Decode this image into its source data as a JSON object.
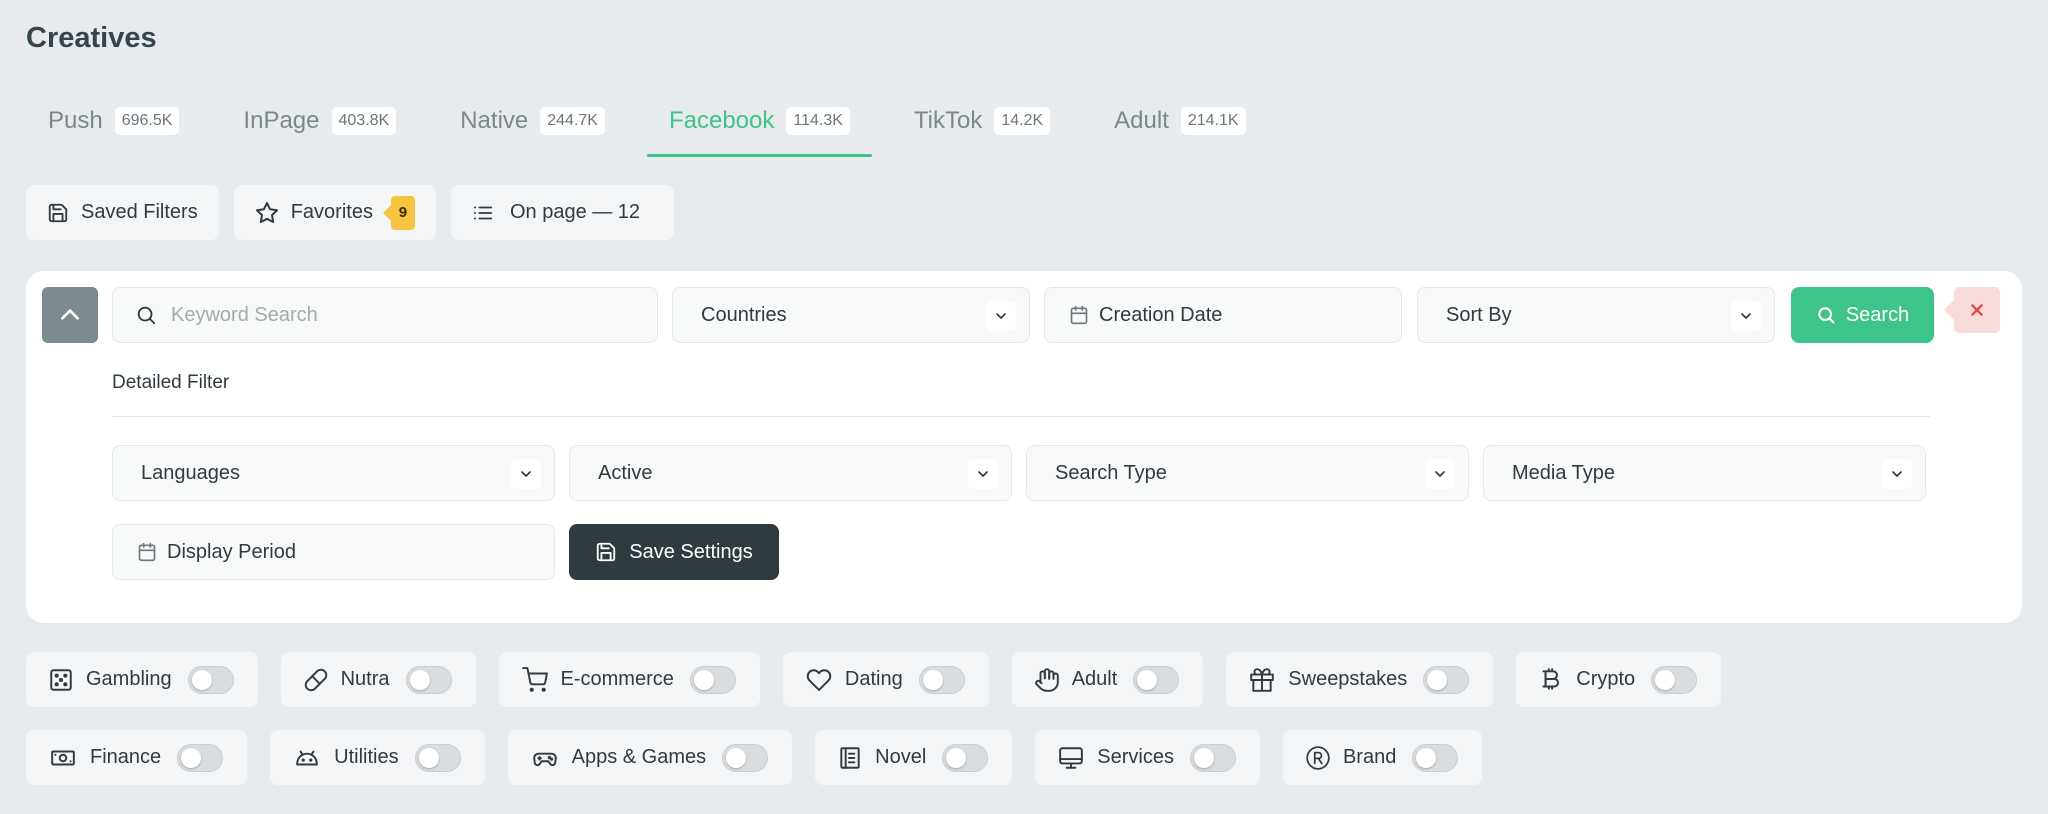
{
  "page": {
    "title": "Creatives"
  },
  "tabs": [
    {
      "label": "Push",
      "count": "696.5K",
      "active": false
    },
    {
      "label": "InPage",
      "count": "403.8K",
      "active": false
    },
    {
      "label": "Native",
      "count": "244.7K",
      "active": false
    },
    {
      "label": "Facebook",
      "count": "114.3K",
      "active": true
    },
    {
      "label": "TikTok",
      "count": "14.2K",
      "active": false
    },
    {
      "label": "Adult",
      "count": "214.1K",
      "active": false
    }
  ],
  "toolbar": {
    "saved_filters": "Saved Filters",
    "favorites": "Favorites",
    "favorites_count": "9",
    "on_page": "On page — 12"
  },
  "filters": {
    "keyword_placeholder": "Keyword Search",
    "countries": "Countries",
    "creation_date": "Creation Date",
    "sort_by": "Sort By",
    "search": "Search",
    "detailed_filter": "Detailed Filter",
    "languages": "Languages",
    "active": "Active",
    "search_type": "Search Type",
    "media_type": "Media Type",
    "display_period": "Display Period",
    "save_settings": "Save Settings"
  },
  "categories_row1": [
    {
      "label": "Gambling",
      "icon": "dice-icon",
      "on": false
    },
    {
      "label": "Nutra",
      "icon": "pill-icon",
      "on": false
    },
    {
      "label": "E-commerce",
      "icon": "cart-icon",
      "on": false
    },
    {
      "label": "Dating",
      "icon": "heart-icon",
      "on": false
    },
    {
      "label": "Adult",
      "icon": "hand-icon",
      "on": false
    },
    {
      "label": "Sweepstakes",
      "icon": "gift-icon",
      "on": false
    },
    {
      "label": "Crypto",
      "icon": "bitcoin-icon",
      "on": false
    }
  ],
  "categories_row2": [
    {
      "label": "Finance",
      "icon": "banknote-icon",
      "on": false
    },
    {
      "label": "Utilities",
      "icon": "android-icon",
      "on": false
    },
    {
      "label": "Apps & Games",
      "icon": "gamepad-icon",
      "on": false
    },
    {
      "label": "Novel",
      "icon": "book-icon",
      "on": false
    },
    {
      "label": "Services",
      "icon": "monitor-icon",
      "on": false
    },
    {
      "label": "Brand",
      "icon": "registered-icon",
      "on": false
    }
  ],
  "colors": {
    "accent": "#3ec488",
    "background": "#e8ebee",
    "dark_button": "#2e3c40",
    "badge": "#f5c542",
    "clear_bg": "#f8dcdc",
    "clear_x": "#e04848"
  }
}
